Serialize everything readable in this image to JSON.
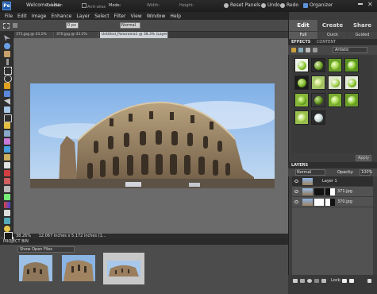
{
  "titlebar": {
    "logo": "Pe",
    "welcome": "Welcome, Lisa",
    "reset_panels": "Reset Panels",
    "undo": "Undo",
    "redo": "Redo",
    "organizer": "Organizer"
  },
  "menu": [
    "File",
    "Edit",
    "Image",
    "Enhance",
    "Layer",
    "Select",
    "Filter",
    "View",
    "Window",
    "Help"
  ],
  "options_bar": {
    "feather_label": "Feather:",
    "feather_value": "0 px",
    "anti_alias": "Anti-alias",
    "mode_label": "Mode:",
    "mode_value": "Normal",
    "width_label": "Width:",
    "height_label": "Height:"
  },
  "doc_tabs": [
    "371.jpg @ 33.1% (RGB/8)",
    "370.jpg @ 33.1% (RGB/8)",
    "Untitled_Panorama1 @ 38.3% (Layer 1, RGB/8)*"
  ],
  "status": {
    "zoom": "38.26%",
    "doc_size": "12.067 inches x 5.172 inches (1..."
  },
  "project_bin": {
    "title": "PROJECT BIN",
    "show_open": "Show Open Files"
  },
  "panel": {
    "tabs": [
      "Edit",
      "Create",
      "Share"
    ],
    "subtabs": [
      "Full",
      "Quick",
      "Guided"
    ],
    "effects_tab": "EFFECTS",
    "content_tab": "CONTENT",
    "filter_dropdown": "Artistic",
    "apply": "Apply",
    "layers_title": "LAYERS",
    "blend_mode": "Normal",
    "opacity_label": "Opacity:",
    "opacity_value": "100%",
    "lock_label": "Lock:"
  },
  "layers": [
    {
      "name": "Layer 1",
      "selected": true
    },
    {
      "name": "371.jpg",
      "selected": false
    },
    {
      "name": "370.jpg",
      "selected": false
    }
  ],
  "colors": {
    "accent_blue": "#3d7dd6",
    "fx_green": "#8aca2a",
    "sky": "#9cc4ec",
    "stone": "#a48a6a"
  }
}
